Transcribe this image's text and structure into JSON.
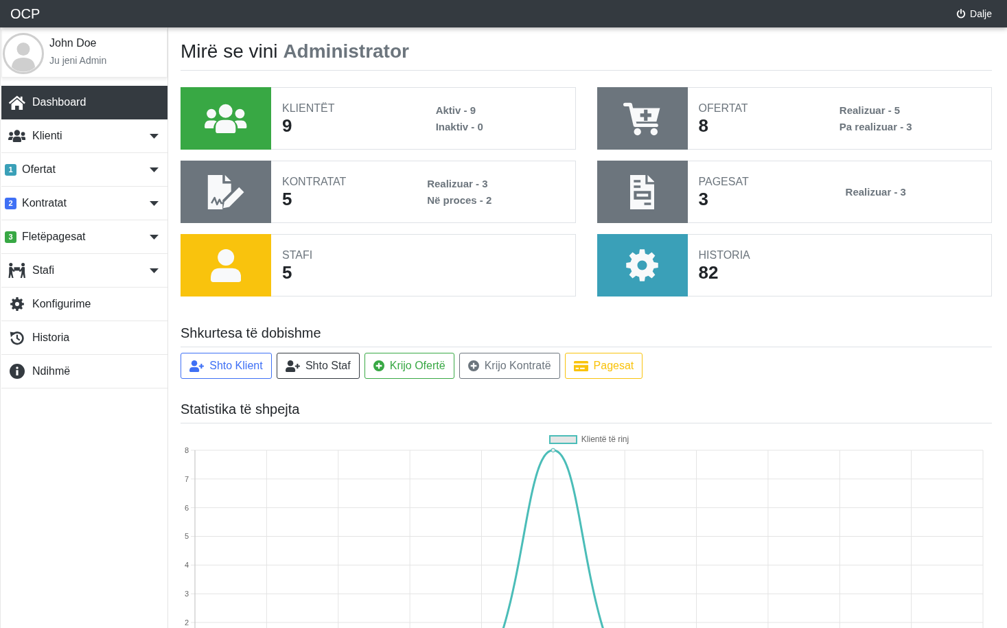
{
  "topbar": {
    "brand": "OCP",
    "logout": "Dalje"
  },
  "sidebar": {
    "user": {
      "name": "John Doe",
      "role": "Ju jeni Admin"
    },
    "items": [
      {
        "kind": "icon",
        "label": "Dashboard",
        "selected": true,
        "dropdown": false
      },
      {
        "kind": "icon",
        "label": "Klienti",
        "selected": false,
        "dropdown": true
      },
      {
        "kind": "badge",
        "badge": "1",
        "color": "#3aa0b8",
        "label": "Ofertat",
        "selected": false,
        "dropdown": true
      },
      {
        "kind": "badge",
        "badge": "2",
        "color": "#3f70f5",
        "label": "Kontratat",
        "selected": false,
        "dropdown": true
      },
      {
        "kind": "badge",
        "badge": "3",
        "color": "#38a844",
        "label": "Fletëpagesat",
        "selected": false,
        "dropdown": true
      },
      {
        "kind": "icon",
        "label": "Stafi",
        "selected": false,
        "dropdown": true
      },
      {
        "kind": "icon",
        "label": "Konfigurime",
        "selected": false,
        "dropdown": false
      },
      {
        "kind": "icon",
        "label": "Historia",
        "selected": false,
        "dropdown": false
      },
      {
        "kind": "icon",
        "label": "Ndihmë",
        "selected": false,
        "dropdown": false
      }
    ]
  },
  "page": {
    "title": "Mirë se vini **Administrator**"
  },
  "cards": [
    {
      "label": "KLIENTËT",
      "value": "9",
      "details": [
        "Aktiv - 9",
        "Inaktiv - 0"
      ],
      "color": "#38a844"
    },
    {
      "label": "OFERTAT",
      "value": "8",
      "details": [
        "Realizuar - 5",
        "Pa realizuar - 3"
      ],
      "color": "#6c757d"
    },
    {
      "label": "KONTRATAT",
      "value": "5",
      "details": [
        "Realizuar - 3",
        "Në proces - 2"
      ],
      "color": "#6c757d"
    },
    {
      "label": "PAGESAT",
      "value": "3",
      "details": [
        "Realizuar - 3"
      ],
      "color": "#6c757d"
    },
    {
      "label": "STAFI",
      "value": "5",
      "color": "#f9c30d"
    },
    {
      "label": "HISTORIA",
      "value": "82",
      "color": "#3aa0b8"
    }
  ],
  "shortcuts": {
    "title": "Shkurtesa të dobishme",
    "buttons": [
      {
        "label": "Shto Klient",
        "color": "#3f70f5"
      },
      {
        "label": "Shto Staf",
        "color": "#343a40"
      },
      {
        "label": "Krijo Ofertë",
        "color": "#38a844"
      },
      {
        "label": "Krijo Kontratë",
        "color": "#6c757d"
      },
      {
        "label": "Pagesat",
        "color": "#f9c30d"
      }
    ]
  },
  "statistics": {
    "title": "Statistika të shpejta",
    "chart": {
      "legend": "Klientë të rinj",
      "y_axis_labels": [
        "8",
        "7",
        "6",
        "5",
        "4",
        "3",
        "2"
      ]
    }
  }
}
